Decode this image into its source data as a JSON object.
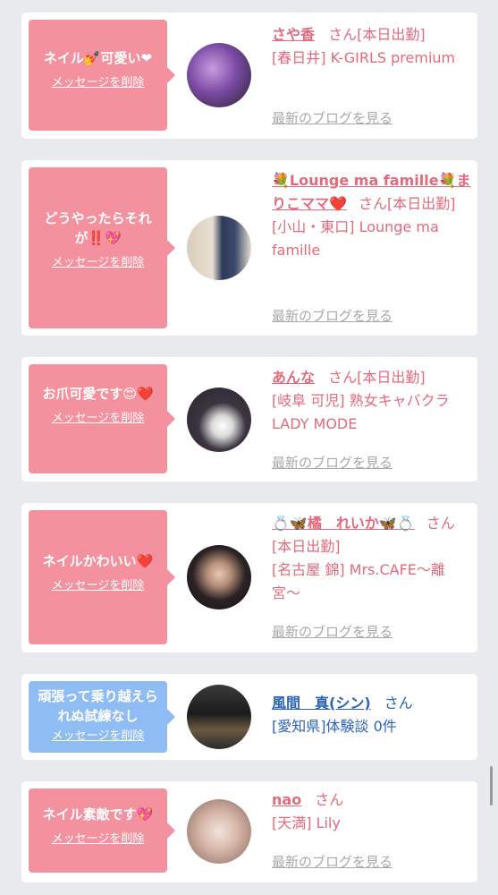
{
  "cards": [
    {
      "bubble_text": "ネイル💅可愛い❤",
      "delete_label": "メッセージを削除",
      "name": "さや香",
      "san": "さん",
      "status": "[本日出勤]",
      "shop": "[春日井] K-GIRLS premium",
      "blog_label": "最新のブログを見る"
    },
    {
      "bubble_text": "どうやったらそれが‼️💖",
      "delete_label": "メッセージを削除",
      "name": "💐Lounge ma famille💐まりこママ❤️",
      "san": "さん",
      "status": "[本日出勤]",
      "shop": "[小山・東口] Lounge ma famille",
      "blog_label": "最新のブログを見る"
    },
    {
      "bubble_text": "お爪可愛です😍❤️",
      "delete_label": "メッセージを削除",
      "name": "あんな",
      "san": "さん",
      "status": "[本日出勤]",
      "shop": "[岐阜 可児] 熟女キャバクラ LADY MODE",
      "blog_label": "最新のブログを見る"
    },
    {
      "bubble_text": "ネイルかわいい❤️",
      "delete_label": "メッセージを削除",
      "name": "💍🦋橘　れいか🦋💍",
      "san": "さん",
      "status": "[本日出勤]",
      "shop": "[名古屋 錦] Mrs.CAFE〜離宮〜",
      "blog_label": "最新のブログを見る"
    },
    {
      "bubble_text": "頑張って乗り越えられぬ試練なし",
      "delete_label": "メッセージを削除",
      "name": "風間　真(シン)",
      "san": "さん",
      "shop": "[愛知県]体験談 0件"
    },
    {
      "bubble_text": "ネイル素敵です💖",
      "delete_label": "メッセージを削除",
      "name": "nao",
      "san": "さん",
      "shop": "[天満] Lily",
      "blog_label": "最新のブログを見る"
    }
  ],
  "colors": {
    "pink_bubble": "#f4919f",
    "blue_bubble": "#8fbcf3",
    "pink_text": "#e26a7c",
    "blue_text": "#2c64b5"
  }
}
